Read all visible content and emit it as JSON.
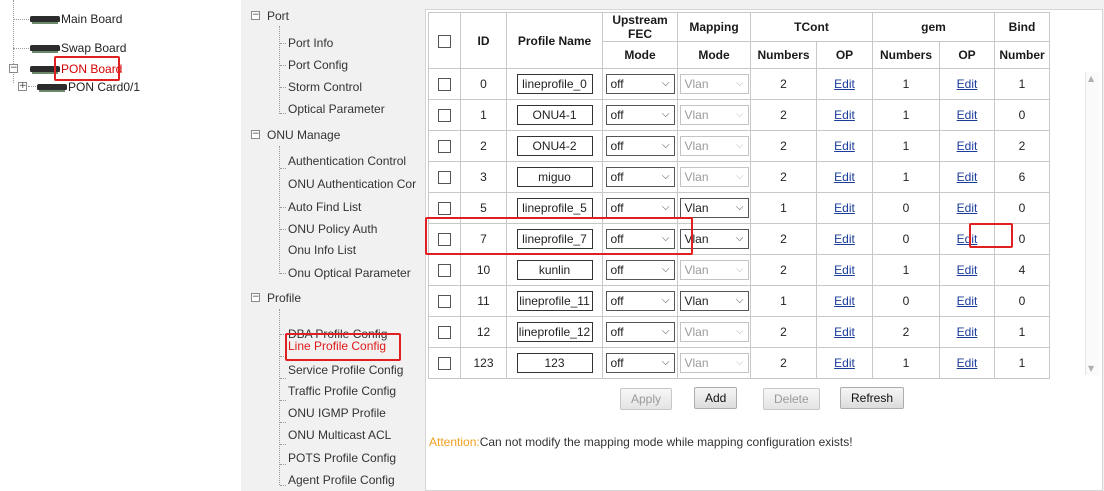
{
  "device_tree": {
    "main_board": "Main Board",
    "swap_board": "Swap Board",
    "pon_board": "PON Board",
    "pon_card": "PON Card0/1"
  },
  "nav": {
    "sections": [
      {
        "id": "port",
        "label": "Port",
        "expanded_symbol": "−",
        "items": [
          "Port Info",
          "Port Config",
          "Storm Control",
          "Optical Parameter"
        ]
      },
      {
        "id": "onu",
        "label": "ONU Manage",
        "expanded_symbol": "−",
        "items": [
          "Authentication Control",
          "ONU Authentication Cor",
          "Auto Find List",
          "ONU Policy Auth",
          "Onu Info List",
          "Onu Optical Parameter"
        ]
      },
      {
        "id": "profile",
        "label": "Profile",
        "expanded_symbol": "−",
        "items": [
          "DBA Profile Config",
          "Line Profile Config",
          "Service Profile Config",
          "Traffic Profile Config",
          "ONU IGMP Profile",
          "ONU Multicast ACL",
          "POTS Profile Config",
          "Agent Profile Config"
        ]
      }
    ],
    "active_item": "Line Profile Config"
  },
  "table": {
    "headers": {
      "id": "ID",
      "profile_name": "Profile Name",
      "upstream_fec": "Upstream FEC",
      "fec_mode": "Mode",
      "mapping": "Mapping",
      "mapping_mode": "Mode",
      "tcont": "TCont",
      "gem": "gem",
      "bind": "Bind",
      "numbers": "Numbers",
      "op": "OP",
      "number": "Number"
    },
    "rows": [
      {
        "id": "0",
        "name": "lineprofile_0",
        "fec": "off",
        "mapping": "Vlan",
        "mapping_enabled": false,
        "tcont_numbers": "2",
        "tcont_op": "Edit",
        "gem_numbers": "1",
        "gem_op": "Edit",
        "bind": "1"
      },
      {
        "id": "1",
        "name": "ONU4-1",
        "fec": "off",
        "mapping": "Vlan",
        "mapping_enabled": false,
        "tcont_numbers": "2",
        "tcont_op": "Edit",
        "gem_numbers": "1",
        "gem_op": "Edit",
        "bind": "0"
      },
      {
        "id": "2",
        "name": "ONU4-2",
        "fec": "off",
        "mapping": "Vlan",
        "mapping_enabled": false,
        "tcont_numbers": "2",
        "tcont_op": "Edit",
        "gem_numbers": "1",
        "gem_op": "Edit",
        "bind": "2"
      },
      {
        "id": "3",
        "name": "miguo",
        "fec": "off",
        "mapping": "Vlan",
        "mapping_enabled": false,
        "tcont_numbers": "2",
        "tcont_op": "Edit",
        "gem_numbers": "1",
        "gem_op": "Edit",
        "bind": "6"
      },
      {
        "id": "5",
        "name": "lineprofile_5",
        "fec": "off",
        "mapping": "Vlan",
        "mapping_enabled": true,
        "tcont_numbers": "1",
        "tcont_op": "Edit",
        "gem_numbers": "0",
        "gem_op": "Edit",
        "bind": "0"
      },
      {
        "id": "7",
        "name": "lineprofile_7",
        "fec": "off",
        "mapping": "Vlan",
        "mapping_enabled": true,
        "tcont_numbers": "2",
        "tcont_op": "Edit",
        "gem_numbers": "0",
        "gem_op": "Edit",
        "bind": "0"
      },
      {
        "id": "10",
        "name": "kunlin",
        "fec": "off",
        "mapping": "Vlan",
        "mapping_enabled": false,
        "tcont_numbers": "2",
        "tcont_op": "Edit",
        "gem_numbers": "1",
        "gem_op": "Edit",
        "bind": "4"
      },
      {
        "id": "11",
        "name": "lineprofile_11",
        "fec": "off",
        "mapping": "Vlan",
        "mapping_enabled": true,
        "tcont_numbers": "1",
        "tcont_op": "Edit",
        "gem_numbers": "0",
        "gem_op": "Edit",
        "bind": "0"
      },
      {
        "id": "12",
        "name": "lineprofile_12",
        "fec": "off",
        "mapping": "Vlan",
        "mapping_enabled": false,
        "tcont_numbers": "2",
        "tcont_op": "Edit",
        "gem_numbers": "2",
        "gem_op": "Edit",
        "bind": "1"
      },
      {
        "id": "123",
        "name": "123",
        "fec": "off",
        "mapping": "Vlan",
        "mapping_enabled": false,
        "tcont_numbers": "2",
        "tcont_op": "Edit",
        "gem_numbers": "1",
        "gem_op": "Edit",
        "bind": "1"
      }
    ]
  },
  "buttons": {
    "apply": "Apply",
    "add": "Add",
    "delete": "Delete",
    "refresh": "Refresh"
  },
  "attention": {
    "label": "Attention:",
    "text": "Can not modify the mapping mode while mapping configuration exists!"
  },
  "icons": {
    "checkbox": "checkbox-icon",
    "dropdown": "chevron-down-icon",
    "board": "board-icon",
    "tree_toggle": "tree-toggle-icon"
  },
  "colors": {
    "highlight": "#e02020",
    "active_nav": "#e01818",
    "link": "#1a3c9a",
    "attention": "#f0a020"
  }
}
